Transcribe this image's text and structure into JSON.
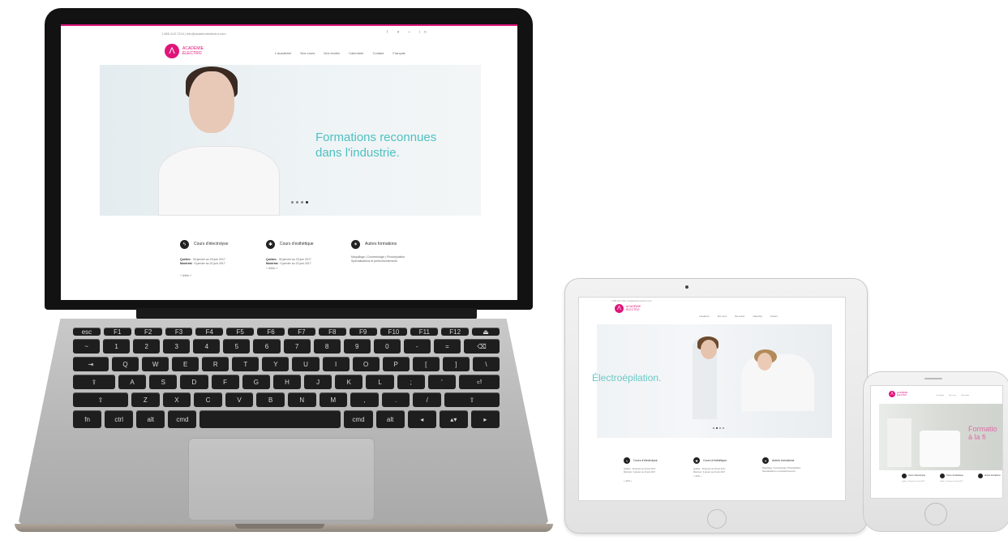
{
  "site": {
    "contact": "1 855 243 7224 | info@academieelectro.com",
    "logo_mark": "Λ",
    "logo_line1": "ACADÉMIE",
    "logo_line2": "ÉLECTRO",
    "social_icons": [
      "facebook-icon",
      "twitter-icon",
      "youtube-icon",
      "linkedin-icon"
    ],
    "social_glyphs": "f ▾ ▪ in",
    "nav": [
      "L'académie",
      "Nos cours",
      "Nos écoles",
      "Calendrier",
      "Contact",
      "Français"
    ],
    "accent_color": "#e0157a",
    "headline_color": "#4fc0c0"
  },
  "laptop": {
    "headline_line1": "Formations reconnues",
    "headline_line2": "dans l'industrie.",
    "slider_dots": 4,
    "active_dot": 3,
    "features": [
      {
        "icon": "lightning-icon",
        "glyph": "ϟ",
        "title": "Cours d'électrolyse",
        "line1_label": "Québec",
        "line1": " : 30 janvier au 20 juin 2017",
        "line2_label": "Montréal",
        "line2": " : 9 janvier au 22 juin 2017",
        "more": "+ d'info +"
      },
      {
        "icon": "star-icon",
        "glyph": "✱",
        "title": "Cours d'esthétique",
        "line1_label": "Québec",
        "line1": " : 30 janvier au 20 juin 2017",
        "line2_label": "Montréal",
        "line2": " : 9 janvier au 22 juin 2017",
        "more": "+ d'info +"
      },
      {
        "icon": "asterisk-icon",
        "glyph": "✶",
        "title": "Autres formations",
        "line1_label": "",
        "line1": "Maquillage | Cosmétologie | Photoépilation",
        "line2_label": "",
        "line2": "Spécialisations et perfectionnements",
        "more": ""
      }
    ]
  },
  "tablet": {
    "headline": "Électroépilation.",
    "slider_dots": 4,
    "features": [
      {
        "title": "Cours d'électrolyse",
        "line1": "Québec : 30 janvier au 20 juin 2017",
        "line2": "Montréal : 9 janvier au 22 juin 2017",
        "more": "+ d'info +"
      },
      {
        "title": "Cours d'esthétique",
        "line1": "Québec : 30 janvier au 20 juin 2017",
        "line2": "Montréal : 9 janvier au 22 juin 2017",
        "more": "+ d'info +"
      },
      {
        "title": "Autres formations",
        "line1": "Maquillage | Cosmétologie | Photoépilation",
        "line2": "Spécialisations et perfectionnements",
        "more": ""
      }
    ]
  },
  "phone": {
    "headline_line1": "Formatio",
    "headline_line2": "à la fi",
    "features": [
      "Cours d'électrolyse",
      "Cours d'esthétique",
      "Autres formations"
    ],
    "feature_line": "Québec : 30 janvier au 20 juin 2017"
  },
  "keyboard": {
    "row1": [
      "esc",
      "F1",
      "F2",
      "F3",
      "F4",
      "F5",
      "F6",
      "F7",
      "F8",
      "F9",
      "F10",
      "F11",
      "F12",
      "⏏"
    ],
    "row2": [
      "~",
      "1",
      "2",
      "3",
      "4",
      "5",
      "6",
      "7",
      "8",
      "9",
      "0",
      "-",
      "=",
      "⌫"
    ],
    "row3": [
      "⇥",
      "Q",
      "W",
      "E",
      "R",
      "T",
      "Y",
      "U",
      "I",
      "O",
      "P",
      "[",
      "]",
      "\\"
    ],
    "row4": [
      "⇪",
      "A",
      "S",
      "D",
      "F",
      "G",
      "H",
      "J",
      "K",
      "L",
      ";",
      "'",
      "⏎"
    ],
    "row5": [
      "⇧",
      "Z",
      "X",
      "C",
      "V",
      "B",
      "N",
      "M",
      ",",
      ".",
      "/",
      "⇧"
    ],
    "row6": [
      "fn",
      "ctrl",
      "alt",
      "cmd",
      "",
      "cmd",
      "alt",
      "◂",
      "▴▾",
      "▸"
    ]
  }
}
